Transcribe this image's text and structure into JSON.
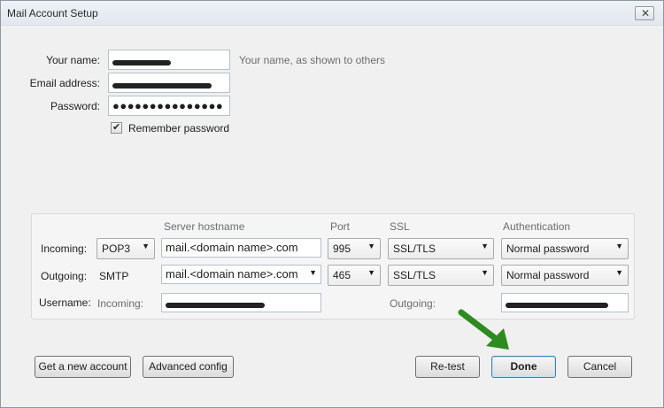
{
  "window": {
    "title": "Mail Account Setup",
    "close_glyph": "✕"
  },
  "identity": {
    "name_label": "Your name:",
    "name_hint": "Your name, as shown to others",
    "email_label": "Email address:",
    "password_label": "Password:",
    "password_value": "●●●●●●●●●●●●●●●",
    "remember_label": "Remember password",
    "remember_checked": true
  },
  "server": {
    "headers": {
      "hostname": "Server hostname",
      "port": "Port",
      "ssl": "SSL",
      "auth": "Authentication"
    },
    "incoming": {
      "label": "Incoming:",
      "protocol": "POP3",
      "hostname": "mail.<domain name>.com",
      "port": "995",
      "ssl": "SSL/TLS",
      "auth": "Normal password"
    },
    "outgoing": {
      "label": "Outgoing:",
      "protocol": "SMTP",
      "hostname": "mail.<domain name>.com",
      "port": "465",
      "ssl": "SSL/TLS",
      "auth": "Normal password"
    },
    "username": {
      "label": "Username:",
      "incoming_label": "Incoming:",
      "outgoing_label": "Outgoing:"
    }
  },
  "buttons": {
    "new_account": "Get a new account",
    "advanced": "Advanced config",
    "retest": "Re-test",
    "done": "Done",
    "cancel": "Cancel"
  },
  "colors": {
    "arrow": "#2e8b1f"
  }
}
